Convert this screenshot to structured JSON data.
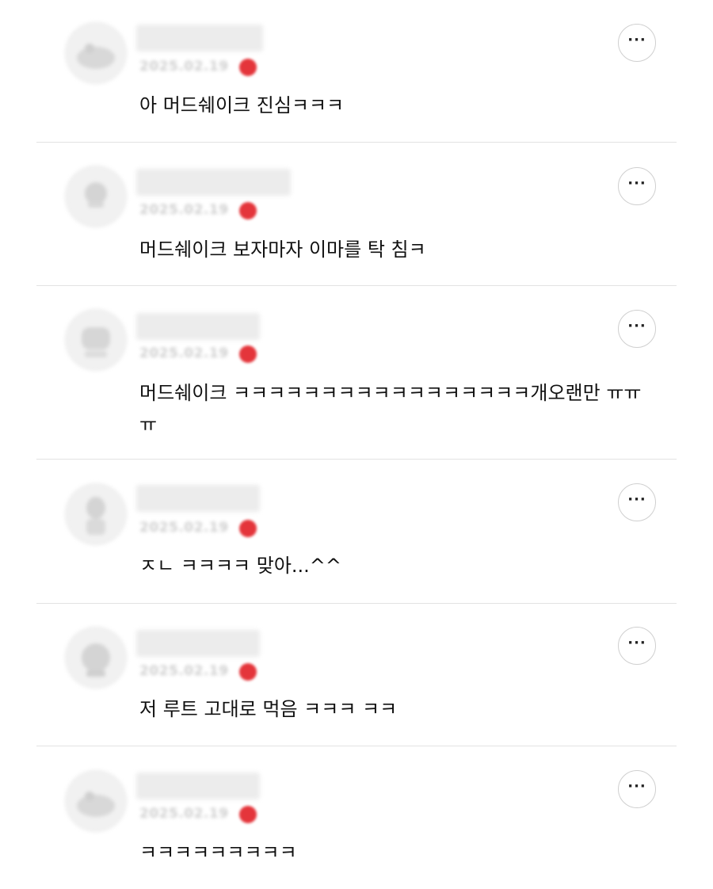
{
  "more_glyph": "···",
  "comments": [
    {
      "date": "2025.02.19",
      "text": "아 머드쉐이크 진심ㅋㅋㅋ"
    },
    {
      "date": "2025.02.19",
      "text": "머드쉐이크 보자마자 이마를 탁 침ㅋ"
    },
    {
      "date": "2025.02.19",
      "text": "머드쉐이크 ㅋㅋㅋㅋㅋㅋㅋㅋㅋㅋㅋㅋㅋㅋㅋㅋㅋ개오랜만 ㅠㅠㅠ"
    },
    {
      "date": "2025.02.19",
      "text": "ㅈㄴ ㅋㅋㅋㅋ 맞아...^^"
    },
    {
      "date": "2025.02.19",
      "text": "저 루트 고대로 먹음 ㅋㅋㅋ ㅋㅋ"
    },
    {
      "date": "2025.02.19",
      "text": "ㅋㅋㅋㅋㅋㅋㅋㅋㅋ"
    }
  ],
  "colors": {
    "badge": "#e4353b",
    "divider": "#e2e2e2",
    "placeholder": "#ececec"
  }
}
